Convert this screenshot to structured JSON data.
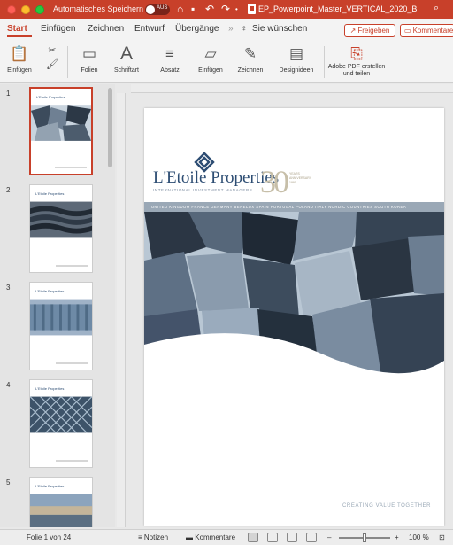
{
  "titlebar": {
    "autosave_label": "Automatisches Speichern",
    "autosave_state": "AUS",
    "document_title": "EP_Powerpoint_Master_VERTICAL_2020_B",
    "accent_color": "#c8402a"
  },
  "ribbon_tabs": [
    {
      "label": "Start",
      "active": true
    },
    {
      "label": "Einfügen",
      "active": false
    },
    {
      "label": "Zeichnen",
      "active": false
    },
    {
      "label": "Entwurf",
      "active": false
    },
    {
      "label": "Übergänge",
      "active": false
    },
    {
      "label": "»",
      "active": false
    },
    {
      "label": "Sie wünschen",
      "active": false
    }
  ],
  "share_button": {
    "label": "Freigeben",
    "icon": "share-icon"
  },
  "comments_button": {
    "label": "Kommentare",
    "icon": "comment-icon"
  },
  "ribbon_groups": [
    {
      "label": "Einfügen",
      "icon": "paste-icon"
    },
    {
      "label": "Folien",
      "icon": "new-slide-icon"
    },
    {
      "label": "Schriftart",
      "icon": "font-icon"
    },
    {
      "label": "Absatz",
      "icon": "paragraph-icon"
    },
    {
      "label": "Einfügen",
      "icon": "insert-shape-icon"
    },
    {
      "label": "Zeichnen",
      "icon": "draw-icon"
    },
    {
      "label": "Designideen",
      "icon": "design-ideas-icon"
    },
    {
      "label": "Adobe PDF erstellen und teilen",
      "icon": "adobe-pdf-icon"
    }
  ],
  "thumbnails": [
    {
      "number": "1",
      "selected": true,
      "logo_text": "L'Etoile Properties"
    },
    {
      "number": "2",
      "selected": false,
      "logo_text": "L'Etoile Properties"
    },
    {
      "number": "3",
      "selected": false,
      "logo_text": "L'Etoile Properties"
    },
    {
      "number": "4",
      "selected": false,
      "logo_text": "L'Etoile Properties"
    },
    {
      "number": "5",
      "selected": false,
      "logo_text": "L'Etoile Properties"
    }
  ],
  "slide": {
    "company_name": "L'Etoile Properties",
    "company_sub": "INTERNATIONAL INVESTMENT MANAGERS",
    "anniversary": "30",
    "anniversary_tag_1": "YEARS",
    "anniversary_tag_2": "ANNIVERSARY",
    "anniversary_tag_3": "1991",
    "countries": "UNITED KINGDOM   FRANCE   GERMANY   BENELUX   SPAIN   PORTUGAL   POLAND   ITALY   NORDIC COUNTRIES   SOUTH KOREA",
    "slogan": "CREATING VALUE TOGETHER",
    "brand_color": "#2d4d73",
    "bar_color": "#9aa8b6"
  },
  "statusbar": {
    "slide_counter": "Folie 1 von 24",
    "notes_label": "Notizen",
    "comments_label": "Kommentare",
    "zoom": "100 %",
    "zoom_minus": "–",
    "zoom_plus": "+"
  }
}
